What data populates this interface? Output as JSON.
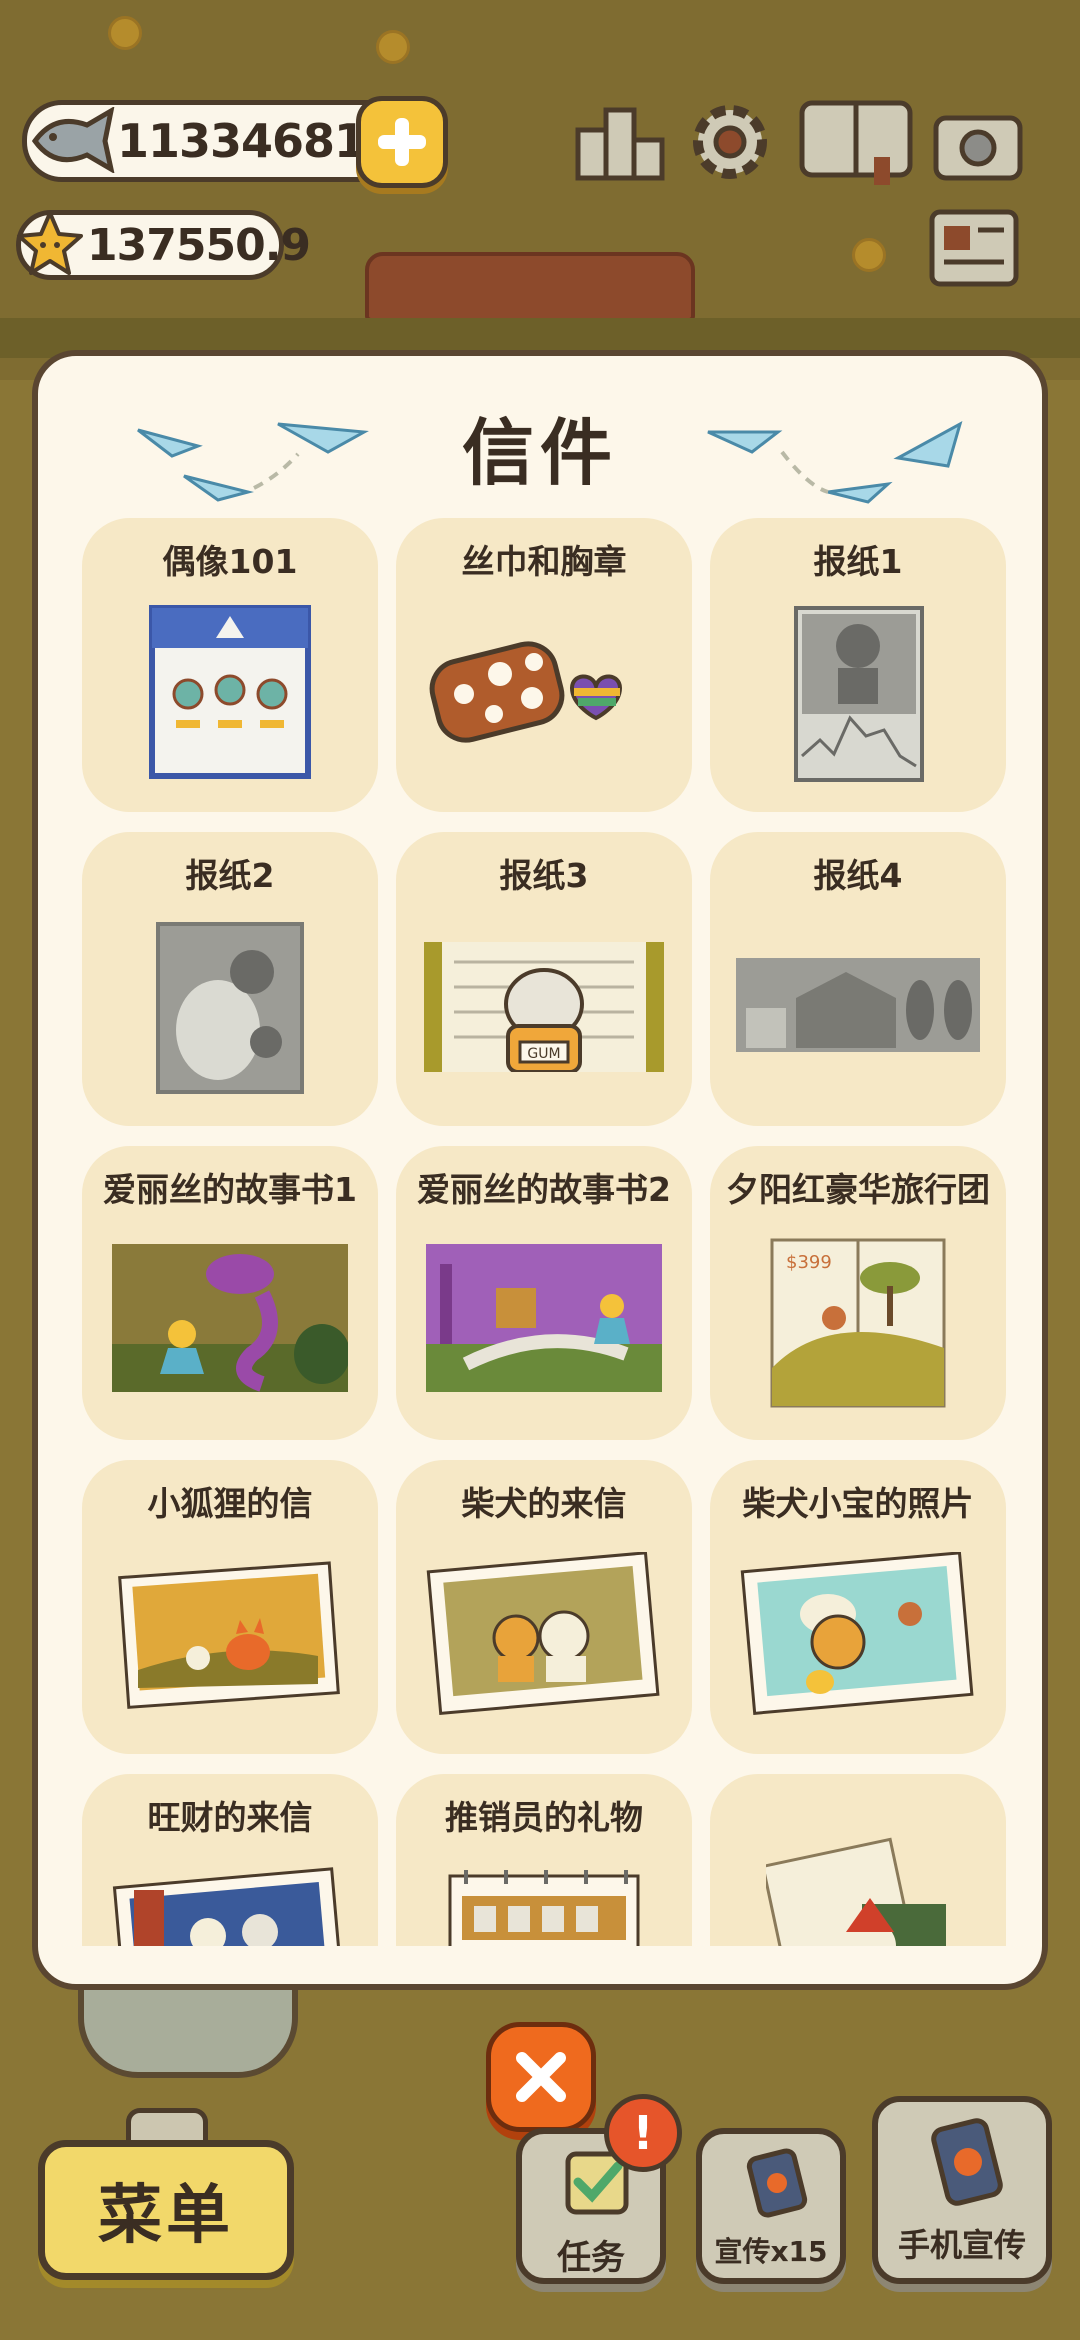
{
  "hud": {
    "fish_count": "113346811",
    "star_count": "137550.9",
    "icons": [
      "fish-icon",
      "plus-icon",
      "star-icon",
      "ranking-icon",
      "gear-icon",
      "book-icon",
      "camera-icon",
      "newspaper-icon"
    ]
  },
  "modal": {
    "title": "信件",
    "cards": [
      {
        "label": "偶像101",
        "image": "idol-poster"
      },
      {
        "label": "丝巾和胸章",
        "image": "scarf-and-badge"
      },
      {
        "label": "报纸1",
        "image": "newspaper-1"
      },
      {
        "label": "报纸2",
        "image": "newspaper-2"
      },
      {
        "label": "报纸3",
        "image": "newspaper-3"
      },
      {
        "label": "报纸4",
        "image": "newspaper-4"
      },
      {
        "label": "爱丽丝的故事书1",
        "image": "alice-storybook-1"
      },
      {
        "label": "爱丽丝的故事书2",
        "image": "alice-storybook-2"
      },
      {
        "label": "夕阳红豪华旅行团",
        "image": "sunset-tour-brochure"
      },
      {
        "label": "小狐狸的信",
        "image": "fox-photo"
      },
      {
        "label": "柴犬的来信",
        "image": "shiba-letter-photo"
      },
      {
        "label": "柴犬小宝的照片",
        "image": "shiba-baby-photo"
      },
      {
        "label": "旺财的来信",
        "image": "wangcai-letter-photo"
      },
      {
        "label": "推销员的礼物",
        "image": "salesman-calendar"
      },
      {
        "label": "",
        "image": "santa-postcard"
      }
    ],
    "price_tag": "$399",
    "gum_sign": "GUM"
  },
  "bottom": {
    "menu_label": "菜单",
    "task_label": "任务",
    "promo_label": "宣传x15",
    "phone_label": "手机宣传",
    "alert": "!"
  },
  "colors": {
    "modal_bg": "#fdf7ea",
    "card_bg": "#f6e8c6",
    "close_orange": "#ef6a1e",
    "menu_yellow": "#f2d86a"
  }
}
